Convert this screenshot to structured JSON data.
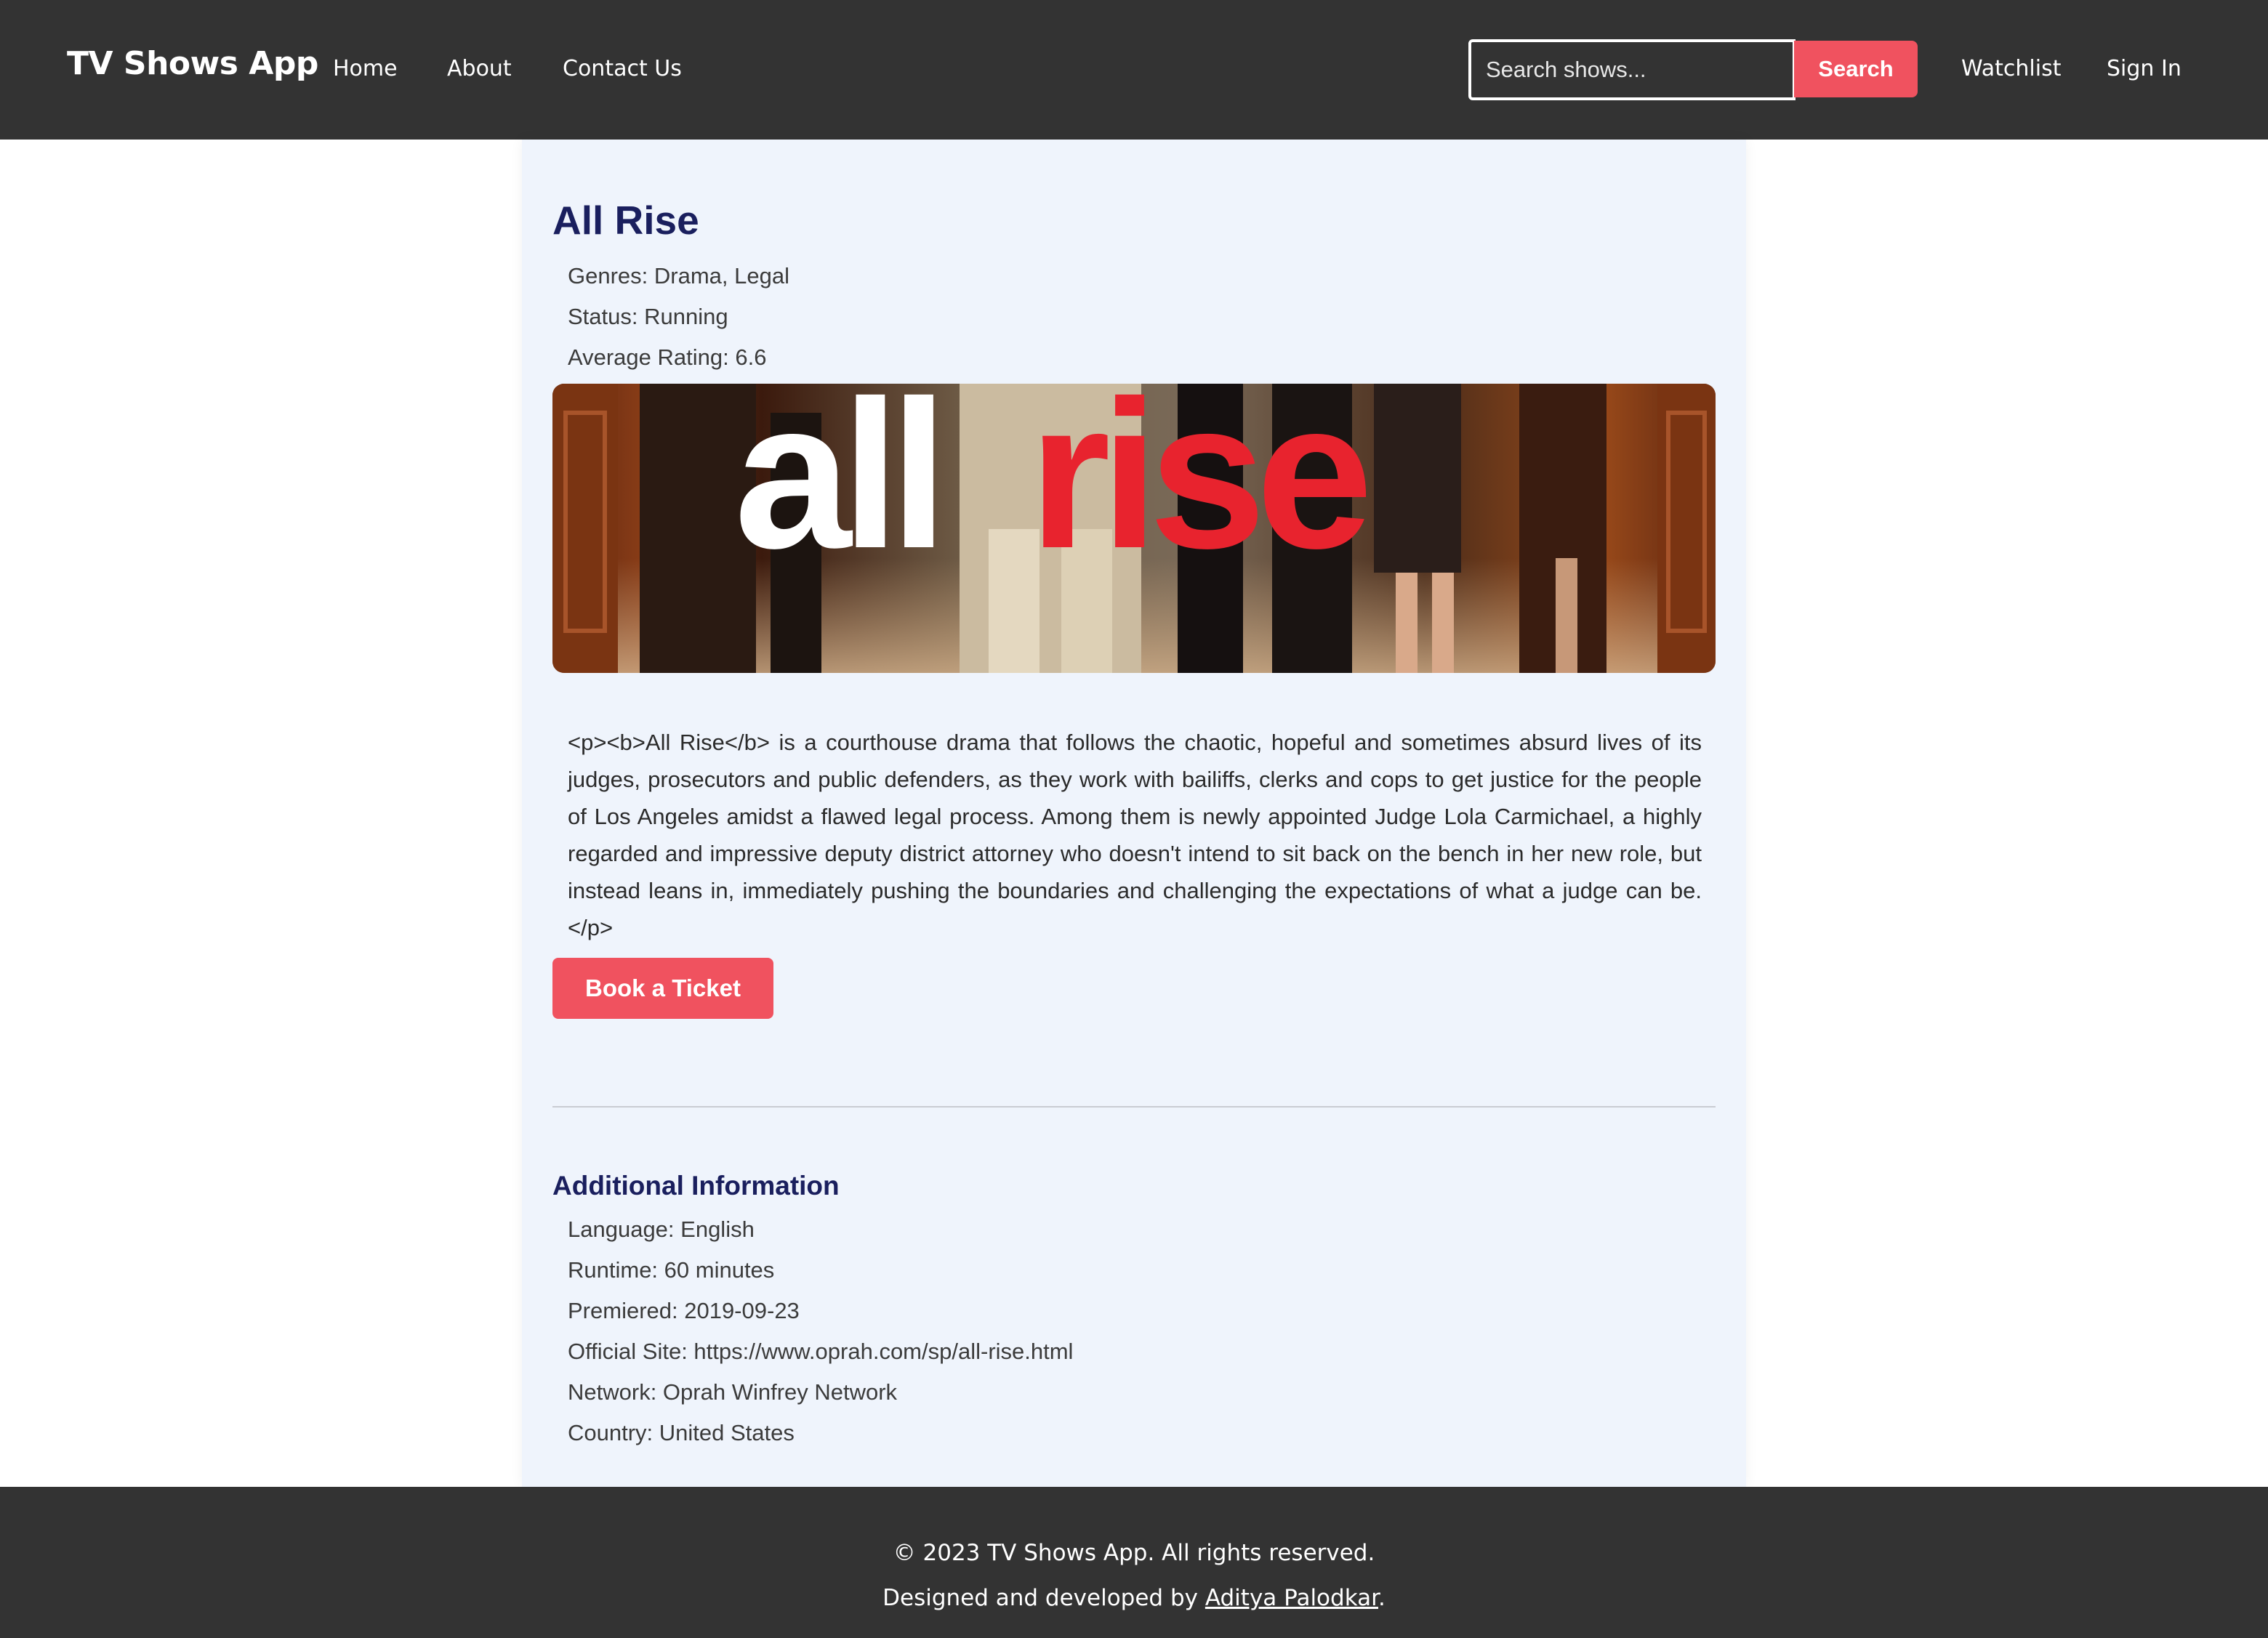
{
  "navbar": {
    "brand": "TV Shows App",
    "links": [
      "Home",
      "About",
      "Contact Us"
    ],
    "search_placeholder": "Search shows...",
    "search_button": "Search",
    "watchlist": "Watchlist",
    "sign_in": "Sign In"
  },
  "show": {
    "title": "All Rise",
    "genres": "Genres: Drama, Legal",
    "status": "Status: Running",
    "rating": "Average Rating: 6.6",
    "banner_text_left": "all",
    "banner_text_right": "rise",
    "summary": "<p><b>All Rise</b> is a courthouse drama that follows the chaotic, hopeful and sometimes absurd lives of its judges, prosecutors and public defenders, as they work with bailiffs, clerks and cops to get justice for the people of Los Angeles amidst a flawed legal process. Among them is newly appointed Judge Lola Carmichael, a highly regarded and impressive deputy district attorney who doesn't intend to sit back on the bench in her new role, but instead leans in, immediately pushing the boundaries and challenging the expectations of what a judge can be.</p>",
    "book_button": "Book a Ticket"
  },
  "additional": {
    "title": "Additional Information",
    "language": "Language: English",
    "runtime": "Runtime: 60 minutes",
    "premiered": "Premiered: 2019-09-23",
    "official_site": "Official Site: https://www.oprah.com/sp/all-rise.html",
    "network": "Network: Oprah Winfrey Network",
    "country": "Country: United States"
  },
  "footer": {
    "copyright": "© 2023 TV Shows App. All rights reserved.",
    "credit_prefix": "Designed and developed by ",
    "credit_name": "Aditya Palodkar",
    "credit_suffix": "."
  },
  "colors": {
    "nav_bg": "#333333",
    "accent": "#f0525f",
    "card_bg": "#eff4fc",
    "title": "#1a1f5e"
  }
}
